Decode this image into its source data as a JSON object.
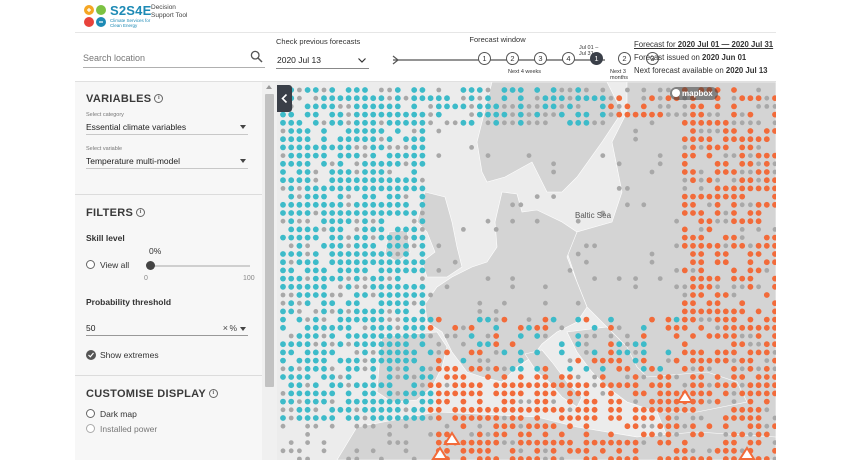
{
  "app": {
    "logo_name": "S2S4E",
    "logo_subtitle": "Climate Services for Clean Energy",
    "logo_tagline": "Decision Support Tool"
  },
  "search": {
    "placeholder": "Search location"
  },
  "previous_forecasts": {
    "label": "Check previous forecasts",
    "selected": "2020 Jul 13"
  },
  "forecast_window": {
    "title": "Forecast window",
    "active_range": "Jul 01 – Jul 31",
    "steps": [
      "1",
      "2",
      "3",
      "4",
      "1",
      "2",
      "3"
    ],
    "active_step_index": 4,
    "weeks_label": "Next 4 weeks",
    "months_label": "Next 3 months"
  },
  "forecast_info": {
    "range_prefix": "Forecast for ",
    "range": "2020 Jul 01 — 2020 Jul 31",
    "issued_prefix": "Forecast issued on ",
    "issued": "2020 Jun 01",
    "next_prefix": "Next forecast available on ",
    "next": "2020 Jul 13"
  },
  "variables": {
    "title": "VARIABLES",
    "category_label": "Select category",
    "category_value": "Essential climate variables",
    "variable_label": "Select variable",
    "variable_value": "Temperature multi-model"
  },
  "filters": {
    "title": "FILTERS",
    "skill_label": "Skill level",
    "view_all": "View all",
    "skill_value": "0%",
    "skill_fraction": 0.0,
    "range_min": "0",
    "range_max": "100",
    "threshold_label": "Probability threshold",
    "threshold_value": "50",
    "threshold_clear": "×",
    "threshold_unit": "%",
    "show_extremes": "Show extremes"
  },
  "display": {
    "title": "CUSTOMISE DISPLAY",
    "dark_map": "Dark map",
    "installed_power": "Installed power"
  },
  "map": {
    "sea_label": "Baltic Sea",
    "attribution": "mapbox",
    "colors": {
      "above": "#f26b3a",
      "below": "#3dbbc9",
      "normal": "#a8a8a8",
      "land": "#d4d4d4",
      "sea": "#ececec"
    }
  }
}
